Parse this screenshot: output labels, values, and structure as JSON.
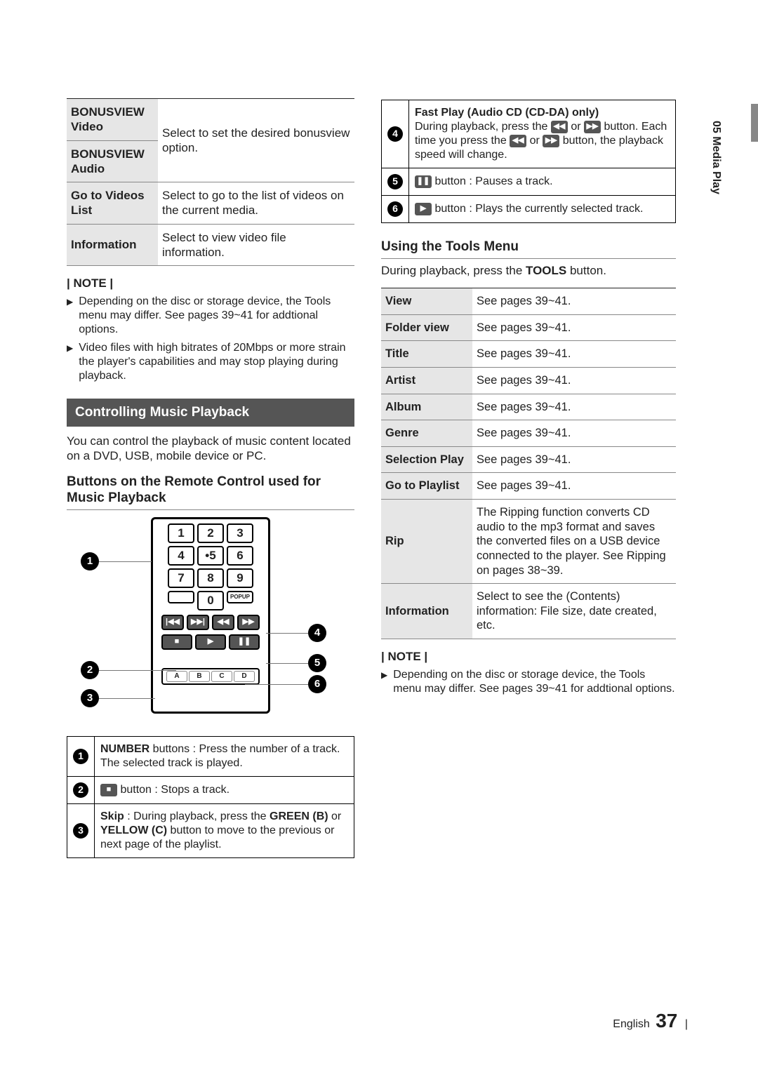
{
  "left": {
    "top_table": [
      {
        "label": "BONUSVIEW Video",
        "desc": "Select to set the desired bonusview option.",
        "merge": true
      },
      {
        "label": "BONUSVIEW Audio",
        "desc": ""
      },
      {
        "label": "Go to Videos List",
        "desc": "Select to go to the list of videos on the current media."
      },
      {
        "label": "Information",
        "desc": "Select to view video file information."
      }
    ],
    "note_label": "| NOTE |",
    "notes": [
      "Depending on the disc or storage device, the Tools menu may differ. See pages 39~41 for addtional options.",
      "Video files with high bitrates of 20Mbps or more strain the player's capabilities and may stop playing during playback."
    ],
    "band": "Controlling Music Playback",
    "intro": "You can control the playback of music content located on a DVD, USB, mobile device or PC.",
    "sub_head": "Buttons on the Remote Control used for Music Playback",
    "remote": {
      "numpad": [
        [
          "1",
          "2",
          "3"
        ],
        [
          "4",
          "5",
          "6"
        ],
        [
          "7",
          "8",
          "9"
        ]
      ],
      "zero": "0",
      "popup": "POPUP",
      "abcd": [
        "A",
        "B",
        "C",
        "D"
      ]
    },
    "desc_table": {
      "r1_a": "NUMBER",
      "r1_b": " buttons : Press the number of a track. The selected track is played.",
      "r2": " button : Stops a track.",
      "r3_a": "Skip",
      "r3_b": " : During playback, press the ",
      "r3_c": "GREEN (B)",
      "r3_d": " or ",
      "r3_e": "YELLOW (C)",
      "r3_f": " button to move to the previous or next page of the playlist."
    }
  },
  "right": {
    "top_table": {
      "r4_title": "Fast Play (Audio CD (CD-DA) only)",
      "r4_a": "During playback, press the ",
      "r4_b": " or ",
      "r4_c": " button. Each time you press the ",
      "r4_d": " or ",
      "r4_e": " button, the playback speed will change.",
      "r5": " button : Pauses a track.",
      "r6": " button : Plays the currently selected track."
    },
    "tools_head": "Using the Tools Menu",
    "tools_intro_a": "During playback, press the ",
    "tools_intro_b": "TOOLS",
    "tools_intro_c": " button.",
    "tools_rows": [
      {
        "label": "View",
        "desc": "See pages 39~41."
      },
      {
        "label": "Folder view",
        "desc": "See pages 39~41."
      },
      {
        "label": "Title",
        "desc": "See pages 39~41."
      },
      {
        "label": "Artist",
        "desc": "See pages 39~41."
      },
      {
        "label": "Album",
        "desc": "See pages 39~41."
      },
      {
        "label": "Genre",
        "desc": "See pages 39~41."
      },
      {
        "label": "Selection Play",
        "desc": "See pages 39~41."
      },
      {
        "label": "Go to Playlist",
        "desc": "See pages 39~41."
      },
      {
        "label": "Rip",
        "desc": "The Ripping function converts CD audio to the mp3 format and saves the converted files on a USB device connected to the player. See Ripping on pages 38~39."
      },
      {
        "label": "Information",
        "desc": "Select to see the (Contents) information: File size, date created, etc."
      }
    ],
    "note_label": "| NOTE |",
    "notes": [
      "Depending on the disc or storage device, the Tools menu may differ. See pages 39~41 for addtional options."
    ]
  },
  "side": {
    "text": "05   Media Play"
  },
  "footer": {
    "lang": "English",
    "page": "37",
    "bar": "|"
  }
}
